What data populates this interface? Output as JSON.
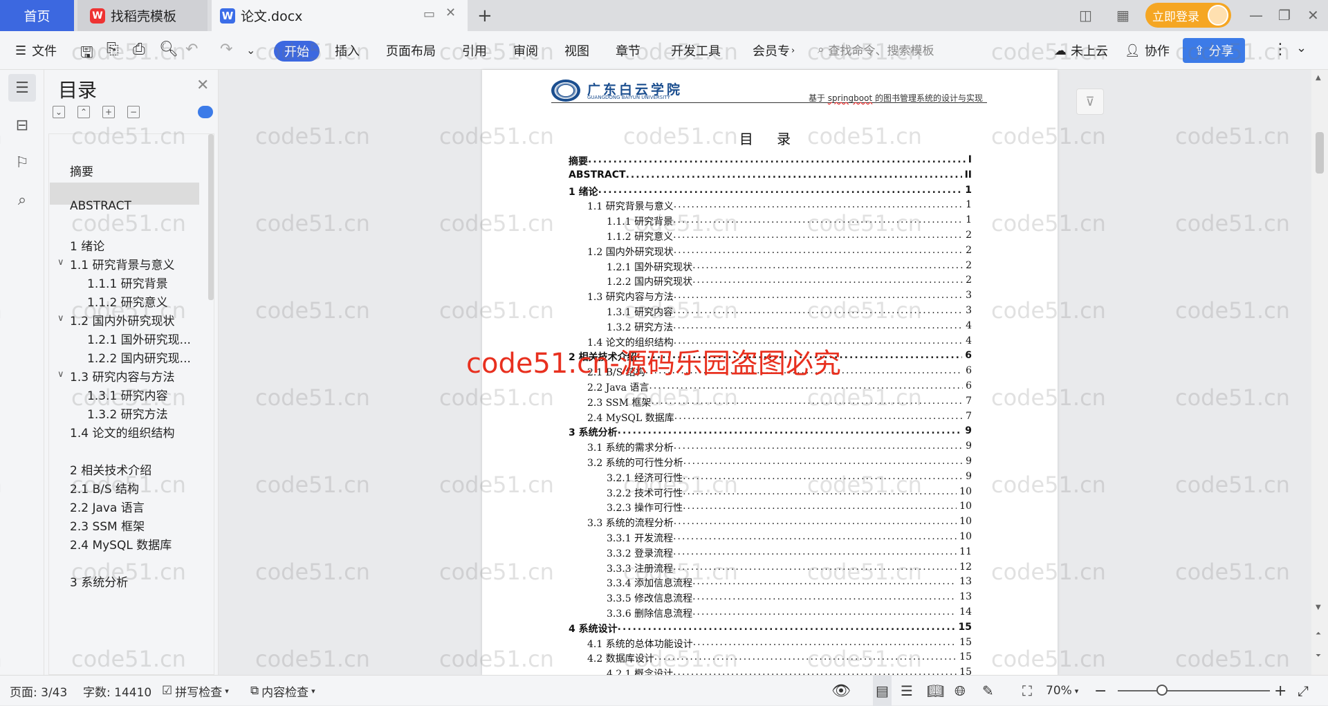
{
  "tabs": {
    "home": "首页",
    "find_template": "找稻壳模板",
    "document": "论文.docx",
    "login": "立即登录"
  },
  "toolbar": {
    "file": "文件",
    "menus": [
      "开始",
      "插入",
      "页面布局",
      "引用",
      "审阅",
      "视图",
      "章节",
      "开发工具",
      "会员专"
    ],
    "search_placeholder": "查找命令、搜索模板",
    "cloud": "未上云",
    "collab": "协作",
    "share": "分享"
  },
  "toc_panel": {
    "title": "目录",
    "items": [
      "摘要",
      "ABSTRACT",
      "1 绪论",
      "1.1 研究背景与意义",
      "1.1.1 研究背景",
      "1.1.2 研究意义",
      "1.2 国内外研究现状",
      "1.2.1 国外研究现...",
      "1.2.2 国内研究现...",
      "1.3 研究内容与方法",
      "1.3.1 研究内容",
      "1.3.2 研究方法",
      "1.4 论文的组织结构",
      "2 相关技术介绍",
      "2.1 B/S 结构",
      "2.2 Java 语言",
      "2.3 SSM 框架",
      "2.4 MySQL 数据库",
      "3 系统分析"
    ]
  },
  "document": {
    "header_univ_cn": "广东白云学院",
    "header_univ_en": "GUANGDONG BAIYUN UNIVERSITY",
    "header_title_pre": "基于 ",
    "header_title_red": "springboot",
    "header_title_post": " 的图书管理系统的设计与实现",
    "toc_title": "目 录",
    "entries": [
      {
        "t": "摘要",
        "p": "I",
        "lv": 1
      },
      {
        "t": "ABSTRACT",
        "p": "II",
        "lv": 1
      },
      {
        "t": "1 绪论",
        "p": "1",
        "lv": 1
      },
      {
        "t": "1.1 研究背景与意义",
        "p": "1",
        "lv": 2
      },
      {
        "t": "1.1.1 研究背景",
        "p": "1",
        "lv": 3
      },
      {
        "t": "1.1.2 研究意义",
        "p": "2",
        "lv": 3
      },
      {
        "t": "1.2 国内外研究现状",
        "p": "2",
        "lv": 2
      },
      {
        "t": "1.2.1 国外研究现状",
        "p": "2",
        "lv": 3
      },
      {
        "t": "1.2.2 国内研究现状",
        "p": "2",
        "lv": 3
      },
      {
        "t": "1.3 研究内容与方法",
        "p": "3",
        "lv": 2
      },
      {
        "t": "1.3.1 研究内容",
        "p": "3",
        "lv": 3
      },
      {
        "t": "1.3.2 研究方法",
        "p": "4",
        "lv": 3
      },
      {
        "t": "1.4 论文的组织结构",
        "p": "4",
        "lv": 2
      },
      {
        "t": "2 相关技术介绍",
        "p": "6",
        "lv": 1
      },
      {
        "t": "2.1 B/S 结构",
        "p": "6",
        "lv": 2
      },
      {
        "t": "2.2 Java 语言",
        "p": "6",
        "lv": 2
      },
      {
        "t": "2.3 SSM 框架",
        "p": "7",
        "lv": 2
      },
      {
        "t": "2.4 MySQL 数据库",
        "p": "7",
        "lv": 2
      },
      {
        "t": "3 系统分析",
        "p": "9",
        "lv": 1
      },
      {
        "t": "3.1 系统的需求分析",
        "p": "9",
        "lv": 2
      },
      {
        "t": "3.2 系统的可行性分析",
        "p": "9",
        "lv": 2
      },
      {
        "t": "3.2.1 经济可行性",
        "p": "9",
        "lv": 3
      },
      {
        "t": "3.2.2 技术可行性",
        "p": "10",
        "lv": 3
      },
      {
        "t": "3.2.3 操作可行性",
        "p": "10",
        "lv": 3
      },
      {
        "t": "3.3 系统的流程分析",
        "p": "10",
        "lv": 2
      },
      {
        "t": "3.3.1 开发流程",
        "p": "10",
        "lv": 3
      },
      {
        "t": "3.3.2 登录流程",
        "p": "11",
        "lv": 3
      },
      {
        "t": "3.3.3 注册流程",
        "p": "12",
        "lv": 3
      },
      {
        "t": "3.3.4 添加信息流程",
        "p": "13",
        "lv": 3
      },
      {
        "t": "3.3.5 修改信息流程",
        "p": "13",
        "lv": 3
      },
      {
        "t": "3.3.6 删除信息流程",
        "p": "14",
        "lv": 3
      },
      {
        "t": "4 系统设计",
        "p": "15",
        "lv": 1
      },
      {
        "t": "4.1 系统的总体功能设计",
        "p": "15",
        "lv": 2
      },
      {
        "t": "4.2 数据库设计",
        "p": "15",
        "lv": 2
      },
      {
        "t": "4.2.1 概念设计",
        "p": "15",
        "lv": 3
      }
    ]
  },
  "watermark": {
    "text": "code51.cn",
    "notice": "code51.cn-源码乐园盗图必究"
  },
  "status": {
    "page": "页面: 3/43",
    "words": "字数: 14410",
    "spell": "拼写检查",
    "content_check": "内容检查",
    "zoom": "70%"
  },
  "colors": {
    "accent": "#3c68e0",
    "login": "#f5a623",
    "watermark_red": "#e8301f"
  }
}
